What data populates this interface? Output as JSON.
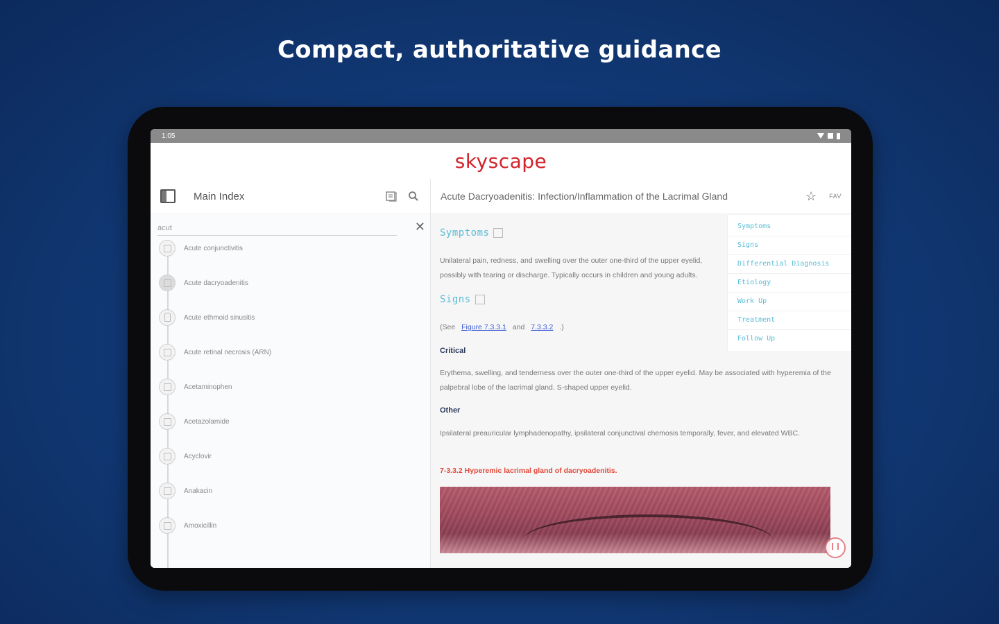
{
  "headline": "Compact, authoritative guidance",
  "status_bar": {
    "time": "1:05"
  },
  "app": {
    "logo_text": "skyscape"
  },
  "left_panel": {
    "title": "Main Index",
    "search": {
      "value": "acut"
    },
    "items": [
      {
        "label": "Acute conjunctivitis"
      },
      {
        "label": "Acute dacryoadenitis"
      },
      {
        "label": "Acute ethmoid sinusitis"
      },
      {
        "label": "Acute retinal necrosis (ARN)"
      },
      {
        "label": "Acetaminophen"
      },
      {
        "label": "Acetazolamide"
      },
      {
        "label": "Acyclovir"
      },
      {
        "label": "Anakacin"
      },
      {
        "label": "Amoxicillin"
      }
    ]
  },
  "document": {
    "title": "Acute Dacryoadenitis: Infection/Inflammation of the Lacrimal Gland",
    "favorite_label": "FAV",
    "sections": {
      "symptoms_heading": "Symptoms",
      "symptoms_text": "Unilateral pain, redness, and swelling over the outer one-third of the upper eyelid, possibly with tearing or discharge. Typically occurs in children and young adults.",
      "signs_heading": "Signs",
      "see_prefix": "(See",
      "figure_link_1": "Figure 7.3.3.1",
      "see_and": "and",
      "figure_link_2": "7.3.3.2",
      "see_suffix": ".)",
      "critical_heading": "Critical",
      "critical_text": "Erythema, swelling, and tenderness over the outer one-third of the upper eyelid. May be associated with hyperemia of the palpebral lobe of the lacrimal gland. S-shaped upper eyelid.",
      "other_heading": "Other",
      "other_text": "Ipsilateral preauricular lymphadenopathy, ipsilateral conjunctival chemosis temporally, fever, and elevated WBC.",
      "figure_caption": "7-3.3.2 Hyperemic lacrimal gland of dacryoadenitis."
    },
    "toc": [
      "Symptoms",
      "Signs",
      "Differential Diagnosis",
      "Etiology",
      "Work Up",
      "Treatment",
      "Follow Up"
    ]
  }
}
